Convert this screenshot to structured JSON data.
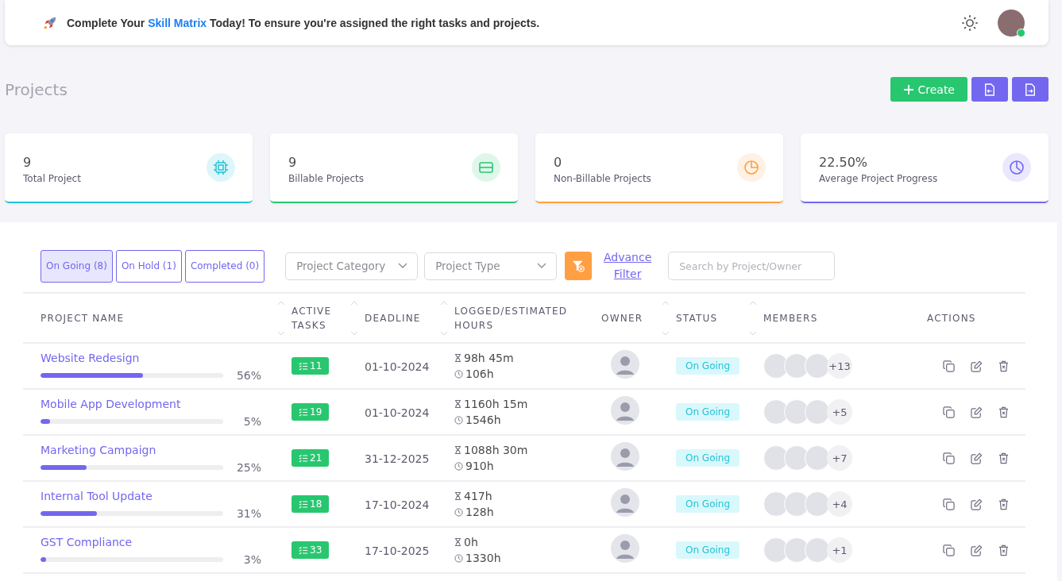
{
  "banner": {
    "prefix": "Complete Your",
    "link": "Skill Matrix",
    "suffix": "Today! To ensure you're assigned the right tasks and projects.",
    "user_online": true
  },
  "page_title": "Projects",
  "actions": {
    "create": "Create"
  },
  "stats": [
    {
      "value": "9",
      "label": "Total Project",
      "color": "#22c3d8",
      "kind": "chip"
    },
    {
      "value": "9",
      "label": "Billable Projects",
      "color": "#28c76f",
      "kind": "card"
    },
    {
      "value": "0",
      "label": "Non-Billable Projects",
      "color": "#ff9f43",
      "kind": "pie"
    },
    {
      "value": "22.50%",
      "label": "Average Project Progress",
      "color": "#7367f0",
      "kind": "clock"
    }
  ],
  "tabs": [
    {
      "label": "On Going (8)",
      "selected": true
    },
    {
      "label": "On Hold (1)",
      "selected": false
    },
    {
      "label": "Completed (0)",
      "selected": false
    }
  ],
  "filters": [
    {
      "placeholder": "Project Category"
    },
    {
      "placeholder": "Project Type"
    }
  ],
  "advance_filter": "Advance Filter",
  "search": {
    "placeholder": "Search by Project/Owner"
  },
  "table": {
    "columns": [
      {
        "label": "PROJECT NAME",
        "sortable": true
      },
      {
        "label": "ACTIVE TASKS",
        "sortable": true
      },
      {
        "label": "DEADLINE",
        "sortable": true
      },
      {
        "label": "LOGGED/ESTIMATED HOURS",
        "sortable": false
      },
      {
        "label": "OWNER",
        "sortable": true
      },
      {
        "label": "STATUS",
        "sortable": true
      },
      {
        "label": "MEMBERS",
        "sortable": false
      },
      {
        "label": "ACTIONS",
        "sortable": false
      }
    ],
    "rows": [
      {
        "name": "Website Redesign",
        "level": 0.56,
        "percent": "56%",
        "tasks": "11",
        "deadline": "01-10-2024",
        "logged": "98h 45m",
        "estimated": "106h",
        "status": "On Going",
        "more_members": "+13"
      },
      {
        "name": "Mobile App Development",
        "level": 0.05,
        "percent": "5%",
        "tasks": "19",
        "deadline": "01-10-2024",
        "logged": "1160h 15m",
        "estimated": "1546h",
        "status": "On Going",
        "more_members": "+5"
      },
      {
        "name": "Marketing Campaign",
        "level": 0.25,
        "percent": "25%",
        "tasks": "21",
        "deadline": "31-12-2025",
        "logged": "1088h 30m",
        "estimated": "910h",
        "status": "On Going",
        "more_members": "+7"
      },
      {
        "name": "Internal Tool Update",
        "level": 0.31,
        "percent": "31%",
        "tasks": "18",
        "deadline": "17-10-2024",
        "logged": "417h",
        "estimated": "128h",
        "status": "On Going",
        "more_members": "+4"
      },
      {
        "name": "GST Compliance",
        "level": 0.03,
        "percent": "3%",
        "tasks": "33",
        "deadline": "17-10-2025",
        "logged": "0h",
        "estimated": "1330h",
        "status": "On Going",
        "more_members": "+1"
      }
    ]
  }
}
